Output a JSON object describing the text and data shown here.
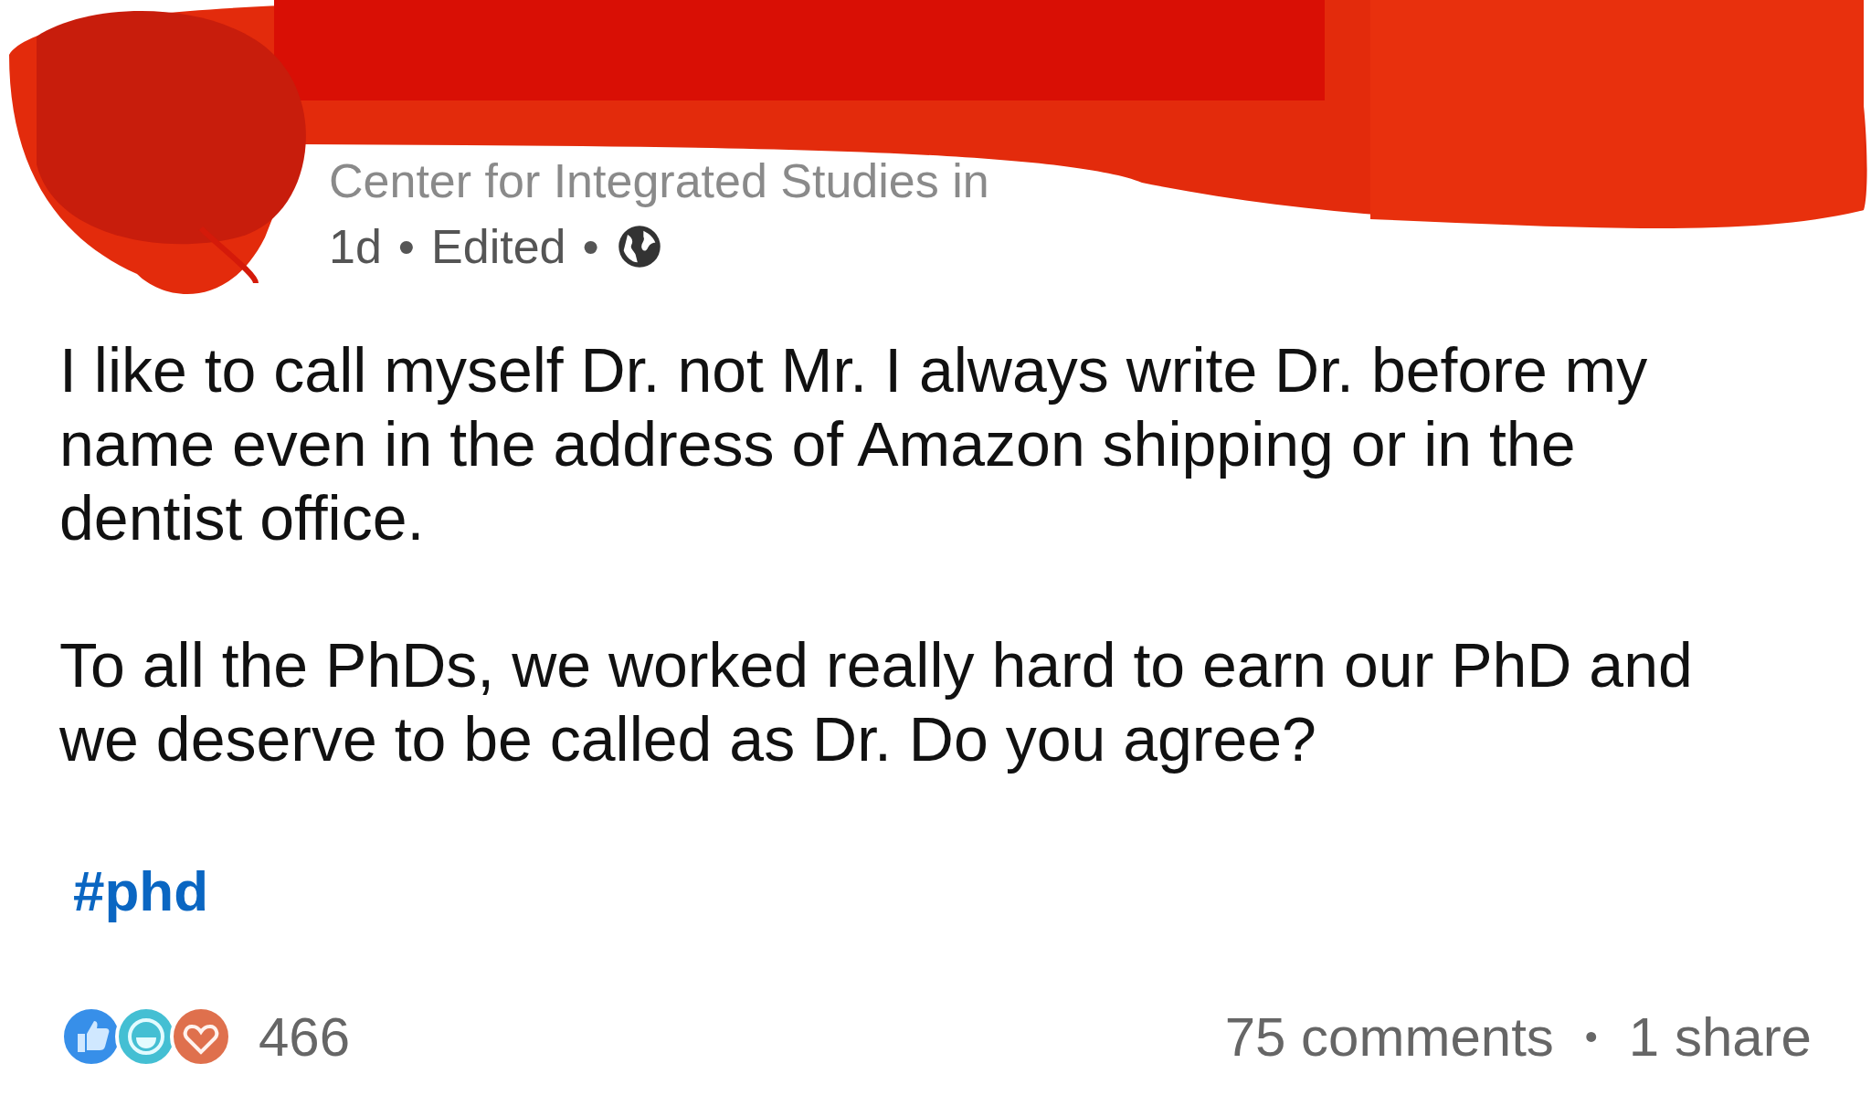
{
  "post": {
    "author_subtitle": "Center for Integrated Studies in",
    "meta": [
      {
        "kind": "text",
        "text": "1d"
      },
      {
        "kind": "text",
        "text": "•"
      },
      {
        "kind": "text",
        "text": "Edited"
      },
      {
        "kind": "text",
        "text": "•"
      },
      {
        "kind": "globe"
      }
    ],
    "paragraphs": [
      "I like to call myself Dr. not Mr. I always write Dr. before my name even in the address of Amazon shipping or in the dentist office.",
      "To all the PhDs, we worked really hard to earn our PhD and we deserve to be called as Dr. Do you agree?"
    ],
    "hashtag": "#phd",
    "reaction_count": "466",
    "comments": "75 comments",
    "separator": "•",
    "shares": "1 share"
  }
}
